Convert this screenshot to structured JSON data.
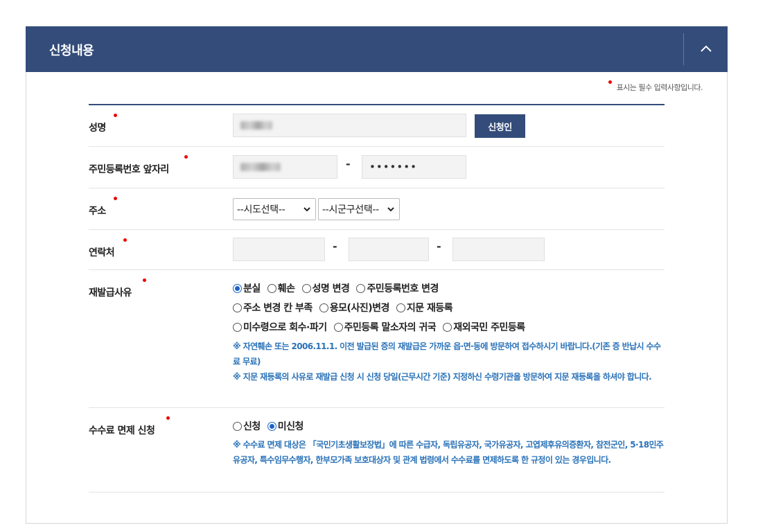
{
  "header": {
    "title": "신청내용"
  },
  "required_note": {
    "text": "표시는 필수 입력사항입니다."
  },
  "form": {
    "name": {
      "label": "성명",
      "button": "신청인"
    },
    "rrn": {
      "label": "주민등록번호 앞자리",
      "back_value": "•••••••",
      "separator": "-"
    },
    "address": {
      "label": "주소",
      "sido": "--시도선택--",
      "sigungu": "--시군구선택--"
    },
    "contact": {
      "label": "연락처",
      "separator": "-"
    },
    "reason": {
      "label": "재발급사유",
      "options": [
        "분실",
        "훼손",
        "성명 변경",
        "주민등록번호 변경",
        "주소 변경 칸 부족",
        "용모(사진)변경",
        "지문 재등록",
        "미수령으로 회수·파기",
        "주민등록 말소자의 귀국",
        "재외국민 주민등록"
      ],
      "selected": "분실",
      "notice1": "※ 자연훼손 또는 2006.11.1. 이전 발급된 증의 재발급은 가까운 읍·면·동에 방문하여 접수하시기 바랍니다.(기존 증 반납시 수수료 무료)",
      "notice2": "※ 지문 재등록의 사유로 재발급 신청 시 신청 당일(근무시간 기준) 지정하신 수령기관을 방문하여 지문 재등록을 하셔야 합니다."
    },
    "fee": {
      "label": "수수료 면제 신청",
      "options": [
        "신청",
        "미신청"
      ],
      "selected": "미신청",
      "notice": "※ 수수료 면제 대상은 「국민기초생활보장법」에 따른 수급자, 독립유공자, 국가유공자, 고엽제후유의증환자, 참전군인, 5·18민주유공자, 특수임무수행자, 한부모가족 보호대상자 및 관계 법령에서 수수료를 면제하도록 한 규정이 있는 경우입니다."
    }
  }
}
